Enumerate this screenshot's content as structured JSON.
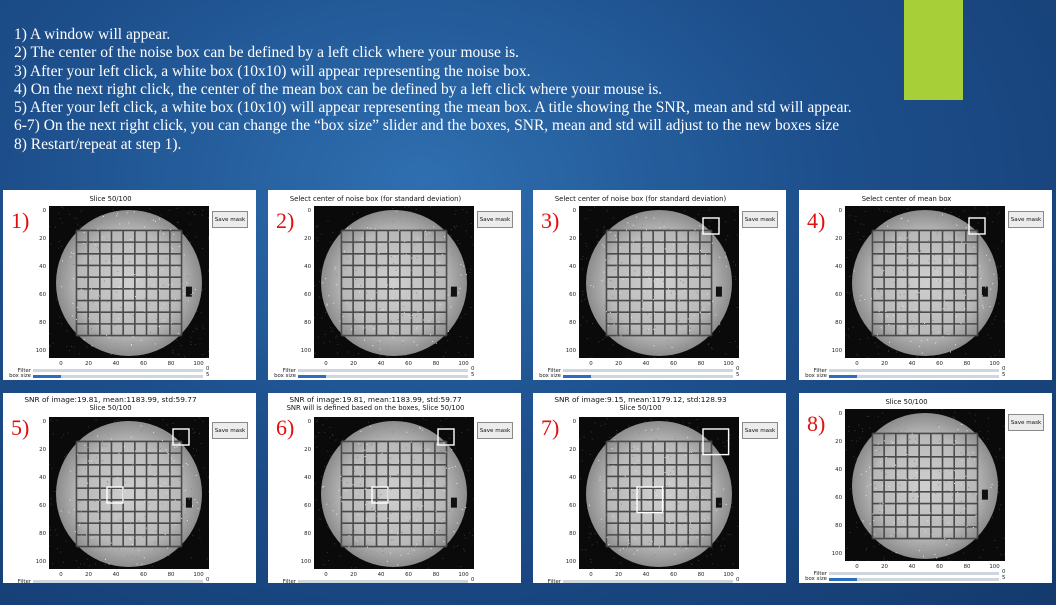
{
  "instructions": [
    "1) A window will appear.",
    "2) The center of the noise box can be defined by a left click where your mouse is.",
    "3) After your left click, a white box (10x10) will appear representing the noise box.",
    "4) On the next right click, the center of the mean box can be defined by a left click where your mouse is.",
    "5) After your left click, a white box (10x10) will appear representing the mean box. A title showing the SNR, mean and std will appear.",
    "6-7) On the next right click, you can change the “box size” slider and the boxes, SNR, mean and std will adjust to the new boxes size",
    "8) Restart/repeat at step 1)."
  ],
  "colors": {
    "background": "#1d4f8c",
    "accent": "#a6cf38",
    "step_number": "#e01010",
    "slider": "#2b6cc4"
  },
  "axes": {
    "yticks": [
      "0",
      "20",
      "40",
      "60",
      "80",
      "100"
    ],
    "xticks": [
      "0",
      "20",
      "40",
      "60",
      "80",
      "100"
    ]
  },
  "controls": {
    "save_label": "Save mask",
    "filter_label": "Filter",
    "box_size_label": "box size",
    "filter_value": "0",
    "box_size_value": "5"
  },
  "panels": [
    {
      "step": "1)",
      "title_lines": [
        "Slice 50/100"
      ],
      "noise_box": false,
      "mean_box": false,
      "box_size": 5
    },
    {
      "step": "2)",
      "title_lines": [
        "Select center of noise box (for standard deviation)"
      ],
      "noise_box": false,
      "mean_box": false,
      "box_size": 5
    },
    {
      "step": "3)",
      "title_lines": [
        "Select center of noise box (for standard deviation)"
      ],
      "noise_box": true,
      "mean_box": false,
      "box_size": 5
    },
    {
      "step": "4)",
      "title_lines": [
        "Select center of mean box"
      ],
      "noise_box": true,
      "mean_box": false,
      "box_size": 5
    },
    {
      "step": "5)",
      "title_lines": [
        "SNR of image:19.81, mean:1183.99, std:59.77",
        "Slice 50/100"
      ],
      "noise_box": true,
      "mean_box": true,
      "box_size": 5
    },
    {
      "step": "6)",
      "title_lines": [
        "SNR of image:19.81, mean:1183.99, std:59.77",
        "SNR will is defined based on the boxes, Slice 50/100"
      ],
      "noise_box": true,
      "mean_box": true,
      "box_size": 5
    },
    {
      "step": "7)",
      "title_lines": [
        "SNR of image:9.15, mean:1179.12, std:128.93",
        "Slice 50/100"
      ],
      "noise_box": true,
      "mean_box": true,
      "box_size": 8
    },
    {
      "step": "8)",
      "title_lines": [
        "Slice 50/100"
      ],
      "noise_box": false,
      "mean_box": false,
      "box_size": 5
    }
  ]
}
